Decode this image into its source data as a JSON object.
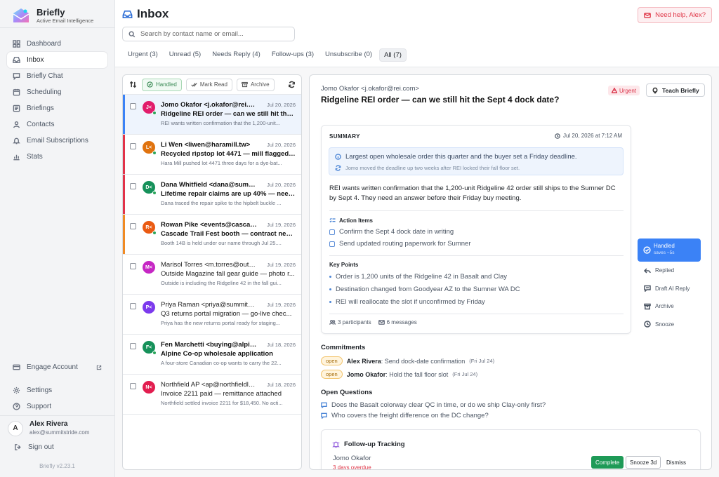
{
  "brand": {
    "name": "Briefly",
    "tagline": "Active Email Intelligence"
  },
  "sidebar": {
    "items": [
      {
        "label": "Dashboard",
        "icon": "grid-icon"
      },
      {
        "label": "Inbox",
        "icon": "inbox-icon",
        "active": true
      },
      {
        "label": "Briefly Chat",
        "icon": "chat-icon"
      },
      {
        "label": "Scheduling",
        "icon": "calendar-icon"
      },
      {
        "label": "Briefings",
        "icon": "briefing-icon"
      },
      {
        "label": "Contacts",
        "icon": "person-icon"
      },
      {
        "label": "Email Subscriptions",
        "icon": "bell-icon"
      },
      {
        "label": "Stats",
        "icon": "bar-chart-icon"
      }
    ],
    "bottom": [
      {
        "label": "Engage Account",
        "icon": "card-icon"
      },
      {
        "label": "Settings",
        "icon": "gear-icon"
      },
      {
        "label": "Support",
        "icon": "help-circle-icon"
      }
    ],
    "user": {
      "initial": "A",
      "name": "Alex Rivera",
      "email": "alex@summitstride.com"
    },
    "signout": "Sign out",
    "version": "Briefly v2.23.1"
  },
  "header": {
    "title": "Inbox",
    "help_button": "Need help, Alex?",
    "search_placeholder": "Search by contact name or email..."
  },
  "tabs": [
    {
      "label": "Urgent (3)"
    },
    {
      "label": "Unread (5)"
    },
    {
      "label": "Needs Reply (4)"
    },
    {
      "label": "Follow-ups (3)"
    },
    {
      "label": "Unsubscribe (0)"
    },
    {
      "label": "All (7)",
      "active": true
    }
  ],
  "toolbar": {
    "handled": "Handled",
    "mark_read": "Mark Read",
    "archive": "Archive"
  },
  "messages": [
    {
      "initials": "J<",
      "avatar_color": "#e21d6b",
      "from": "Jomo Okafor <j.okafor@rei.co...",
      "date": "Jul 20, 2026",
      "subject": "Ridgeline REI order — can we still hit the S...",
      "preview": "REI wants written confirmation that the 1,200-unit...",
      "stripe": "#3b82f6",
      "selected": true,
      "unread": true,
      "online": true
    },
    {
      "initials": "L<",
      "avatar_color": "#e0730f",
      "from": "Li Wen <liwen@haramill.tw>",
      "date": "Jul 20, 2026",
      "subject": "Recycled ripstop lot 4471 — mill flagged a ...",
      "preview": "Hara Mill pushed lot 4471 three days for a dye-bat...",
      "stripe": "#e2334a",
      "unread": true,
      "online": true
    },
    {
      "initials": "D<",
      "avatar_color": "#16915a",
      "from": "Dana Whitfield <dana@summit...",
      "date": "Jul 20, 2026",
      "subject": "Lifetime repair claims are up 40% — need ...",
      "preview": "Dana traced the repair spike to the hipbelt buckle ...",
      "stripe": "#e2334a",
      "unread": true,
      "online": true
    },
    {
      "initials": "R<",
      "avatar_color": "#ea5a12",
      "from": "Rowan Pike <events@cascadet...",
      "date": "Jul 19, 2026",
      "subject": "Cascade Trail Fest booth — contract need...",
      "preview": "Booth 14B is held under our name through Jul 25....",
      "stripe": "#f08a24",
      "unread": true,
      "online": true
    },
    {
      "initials": "M<",
      "avatar_color": "#c627c4",
      "from": "Marisol Torres <m.torres@outsi...",
      "date": "Jul 19, 2026",
      "subject": "Outside Magazine fall gear guide — photo r...",
      "preview": "Outside is including the Ridgeline 42 in the fall gui...",
      "stripe": "",
      "unread": false,
      "online": false
    },
    {
      "initials": "P<",
      "avatar_color": "#7c3aed",
      "from": "Priya Raman <priya@summitstri...",
      "date": "Jul 19, 2026",
      "subject": "Q3 returns portal migration — go-live chec...",
      "preview": "Priya has the new returns portal ready for staging...",
      "stripe": "",
      "unread": false,
      "online": false
    },
    {
      "initials": "F<",
      "avatar_color": "#16915a",
      "from": "Fen Marchetti <buying@alpinec...",
      "date": "Jul 18, 2026",
      "subject": "Alpine Co-op wholesale application",
      "preview": "A four-store Canadian co-op wants to carry the 22...",
      "stripe": "",
      "unread": true,
      "online": true
    },
    {
      "initials": "N<",
      "avatar_color": "#e21d4f",
      "from": "Northfield AP <ap@northfieldlog...",
      "date": "Jul 18, 2026",
      "subject": "Invoice 2211 paid — remittance attached",
      "preview": "Northfield settled invoice 2211 for $18,450. No acti...",
      "stripe": "",
      "unread": false,
      "online": false
    }
  ],
  "detail": {
    "from": "Jomo Okafor <j.okafor@rei.com>",
    "subject": "Ridgeline REI order — can we still hit the Sept 4 dock date?",
    "urgent": "Urgent",
    "teach": "Teach Briefly",
    "summary_label": "SUMMARY",
    "summary_date": "Jul 20, 2026 at 7:12 AM",
    "highlight": "Largest open wholesale order this quarter and the buyer set a Friday deadline.",
    "highlight_sub": "Jomo moved the deadline up two weeks after REI locked their fall floor set.",
    "body": "REI wants written confirmation that the 1,200-unit Ridgeline 42 order still ships to the Sumner DC by Sept 4. They need an answer before their Friday buy meeting.",
    "action_title": "Action Items",
    "actions": [
      "Confirm the Sept 4 dock date in writing",
      "Send updated routing paperwork for Sumner"
    ],
    "kp_title": "Key Points",
    "key_points": [
      "Order is 1,200 units of the Ridgeline 42 in Basalt and Clay",
      "Destination changed from Goodyear AZ to the Sumner WA DC",
      "REI will reallocate the slot if unconfirmed by Friday"
    ],
    "participants": "3 participants",
    "messages": "6 messages",
    "rail": {
      "handled": "Handled",
      "handled_sub": "saves ~5s",
      "items": [
        {
          "label": "Replied",
          "icon": "reply-icon"
        },
        {
          "label": "Draft AI Reply",
          "icon": "ai-draft-icon"
        },
        {
          "label": "Archive",
          "icon": "archive-icon"
        },
        {
          "label": "Snooze",
          "icon": "clock-icon"
        }
      ]
    },
    "commitments_title": "Commitments",
    "commitments": [
      {
        "status": "open",
        "who": "Alex Rivera",
        "what": ": Send dock-date confirmation",
        "date": "(Fri Jul 24)"
      },
      {
        "status": "open",
        "who": "Jomo Okafor",
        "what": ": Hold the fall floor slot",
        "date": "(Fri Jul 24)"
      }
    ],
    "questions_title": "Open Questions",
    "questions": [
      "Does the Basalt colorway clear QC in time, or do we ship Clay-only first?",
      "Who covers the freight difference on the DC change?"
    ],
    "followup": {
      "title": "Follow-up Tracking",
      "name": "Jomo Okafor",
      "overdue": "3 days overdue",
      "complete": "Complete",
      "snooze": "Snooze 3d",
      "dismiss": "Dismiss"
    }
  }
}
